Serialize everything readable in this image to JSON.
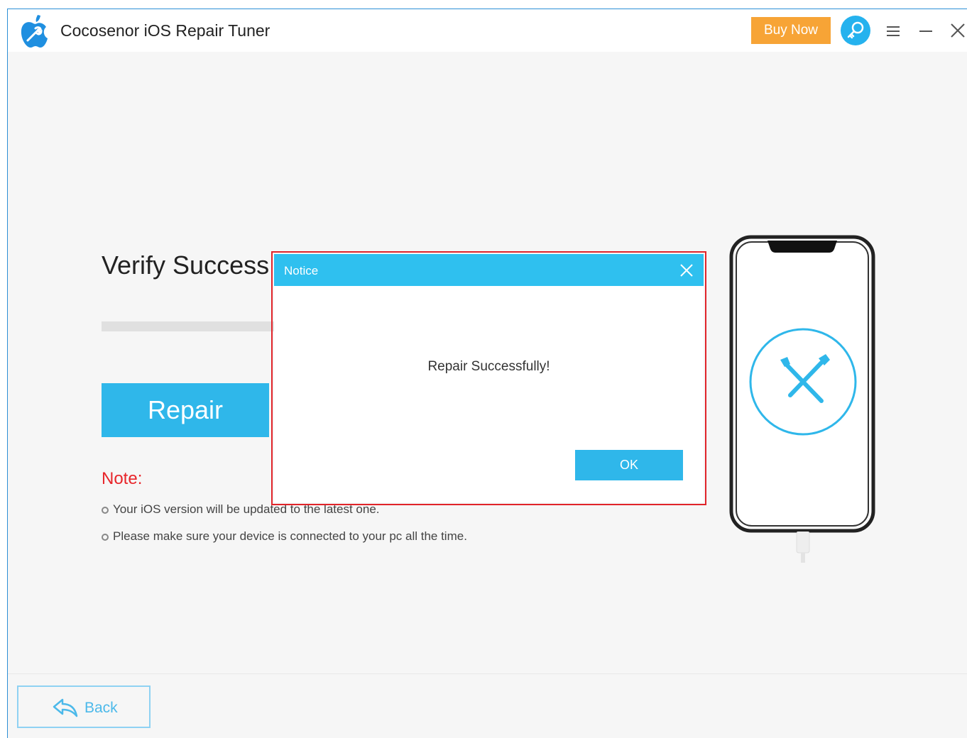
{
  "titlebar": {
    "app_title": "Cocosenor iOS Repair Tuner",
    "buy_label": "Buy Now",
    "icons": [
      "app-logo",
      "key-icon",
      "menu-icon",
      "minimize-icon",
      "close-icon"
    ]
  },
  "main": {
    "page_title": "Verify Success",
    "repair_label": "Repair",
    "note_label": "Note:",
    "notes": [
      "Your iOS version will be updated to the latest one.",
      "Please make sure your device is connected to your pc all the time."
    ]
  },
  "dialog": {
    "title": "Notice",
    "message": "Repair Successfully!",
    "ok_label": "OK"
  },
  "footer": {
    "back_label": "Back"
  },
  "colors": {
    "accent": "#2fb7ea",
    "buy": "#f7a436",
    "note": "#e8262b",
    "highlight": "#e0242a"
  }
}
